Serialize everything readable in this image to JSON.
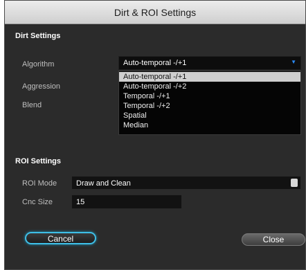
{
  "window": {
    "title": "Dirt & ROI Settings"
  },
  "dirt_settings": {
    "heading": "Dirt Settings",
    "algorithm_label": "Algorithm",
    "algorithm_value": "Auto-temporal -/+1",
    "aggression_label": "Aggression",
    "blend_label": "Blend",
    "options": [
      "Auto-temporal -/+1",
      "Auto-temporal -/+2",
      "Temporal -/+1",
      "Temporal -/+2",
      "Spatial",
      "Median"
    ],
    "selected_index": 0
  },
  "roi_settings": {
    "heading": "ROI Settings",
    "mode_label": "ROI Mode",
    "mode_value": "Draw and Clean",
    "cnc_label": "Cnc Size",
    "cnc_value": "15"
  },
  "buttons": {
    "cancel_label": "Cancel",
    "close_label": "Close"
  },
  "colors": {
    "accent_glow": "#3fc0e8",
    "dropdown_chevron": "#2a8cff"
  }
}
